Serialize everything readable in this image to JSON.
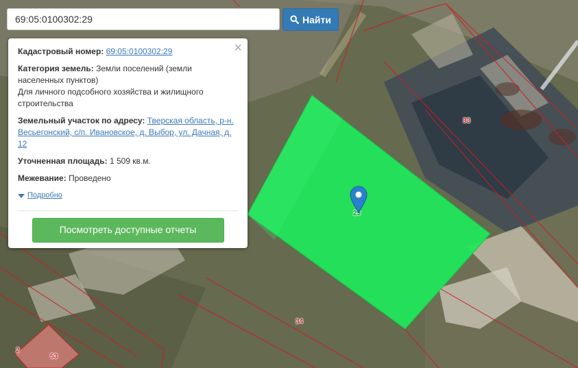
{
  "search": {
    "value": "69:05:0100302:29",
    "button_label": "Найти"
  },
  "popup": {
    "cadastral_label": "Кадастровый номер:",
    "cadastral_value": "69:05:0100302:29",
    "category_label": "Категория земель:",
    "category_value": "Земли поселений (земли населенных пунктов)",
    "usage_value": "Для личного подсобного хозяйства и жилищного строительства",
    "address_label": "Земельный участок по адресу:",
    "address_value": "Тверская область, р-н. Весьегонский, с/п. Ивановское, д. Выбор, ул. Дачная, д. 12",
    "area_label": "Уточненная площадь:",
    "area_value": "1 509 кв.м.",
    "survey_label": "Межевание:",
    "survey_value": "Проведено",
    "more_label": "Подробно",
    "close_glyph": "×",
    "report_button_label": "Посмотреть доступные отчеты"
  },
  "map": {
    "plot_labels": {
      "p33": "33",
      "p34": "34",
      "p53": "53",
      "p2": "2",
      "p29": "29"
    },
    "colors": {
      "selected_parcel": "#1ee85a",
      "neighbor_parcel": "#c97a72",
      "boundary": "#cc1f26",
      "marker": "#2a81cb"
    }
  }
}
